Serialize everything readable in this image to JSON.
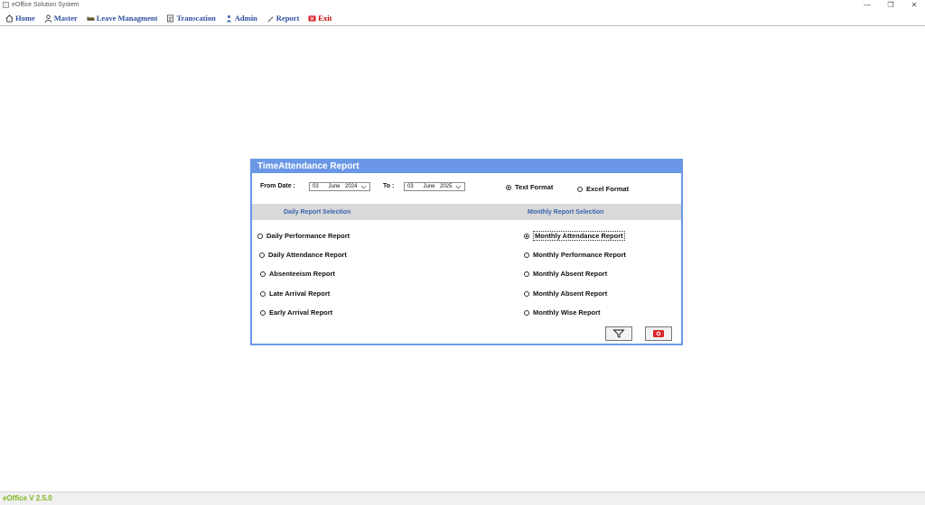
{
  "window": {
    "title": "eOffice Solution System",
    "controls": {
      "minimize": "—",
      "restore": "❐",
      "close": "✕"
    }
  },
  "menu": [
    {
      "label": "Home",
      "icon": "home-icon"
    },
    {
      "label": "Master",
      "icon": "user-icon"
    },
    {
      "label": "Leave Managment",
      "icon": "bed-icon"
    },
    {
      "label": "Transcation",
      "icon": "document-icon"
    },
    {
      "label": "Admin",
      "icon": "admin-icon"
    },
    {
      "label": "Report",
      "icon": "pen-icon"
    },
    {
      "label": "Exit",
      "icon": "exit-icon"
    }
  ],
  "dialog": {
    "title": "TimeAttendance Report",
    "from_label": "From Date :",
    "to_label": "To :",
    "from_date": {
      "day": "03",
      "month": "June",
      "year": "2024"
    },
    "to_date": {
      "day": "03",
      "month": "June",
      "year": "2025"
    },
    "formats": [
      {
        "label": "Text Format",
        "selected": true
      },
      {
        "label": "Excel Format",
        "selected": false
      }
    ],
    "daily_title": "Daily Report Selection",
    "monthly_title": "Monthly Report Selection",
    "daily": [
      {
        "label": "Daily Performance Report",
        "selected": false
      },
      {
        "label": "Daily Attendance Report",
        "selected": false
      },
      {
        "label": "Absenteeism Report",
        "selected": false
      },
      {
        "label": "Late Arrival Report",
        "selected": false
      },
      {
        "label": "Early Arrival Report",
        "selected": false
      }
    ],
    "monthly": [
      {
        "label": "Monthly Attendance Report",
        "selected": true
      },
      {
        "label": "Monthly Performance Report",
        "selected": false
      },
      {
        "label": "Monthly Absent Report",
        "selected": false
      },
      {
        "label": "Monthly Absent Report",
        "selected": false
      },
      {
        "label": "Monthly Wise Report",
        "selected": false
      }
    ],
    "buttons": {
      "filter_icon": "filter-icon",
      "close_icon": "close-window-icon"
    },
    "colors": {
      "header": "#6a98e6",
      "section_title": "#3b63ad",
      "close_button": "#d9242a"
    }
  },
  "footer": {
    "version": "eOffice  V 2.5.0"
  }
}
